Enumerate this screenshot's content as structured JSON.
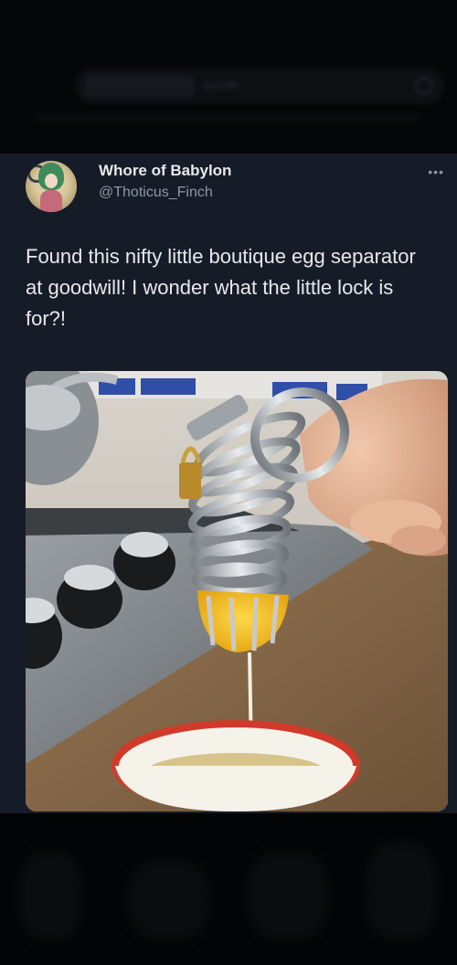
{
  "search": {
    "hint": "puzzle"
  },
  "tweet": {
    "display_name": "Whore of Babylon",
    "handle": "@Thoticus_Finch",
    "more_label": "•••",
    "text": "Found this nifty little boutique egg separator at goodwill! I wonder what the little lock is for?!",
    "avatar_icon": "profile-avatar",
    "photo_icon": "egg-separator-photo"
  },
  "colors": {
    "card_background": "#161c27",
    "text_primary": "#e7e9ea",
    "text_secondary": "#8b98a5"
  }
}
